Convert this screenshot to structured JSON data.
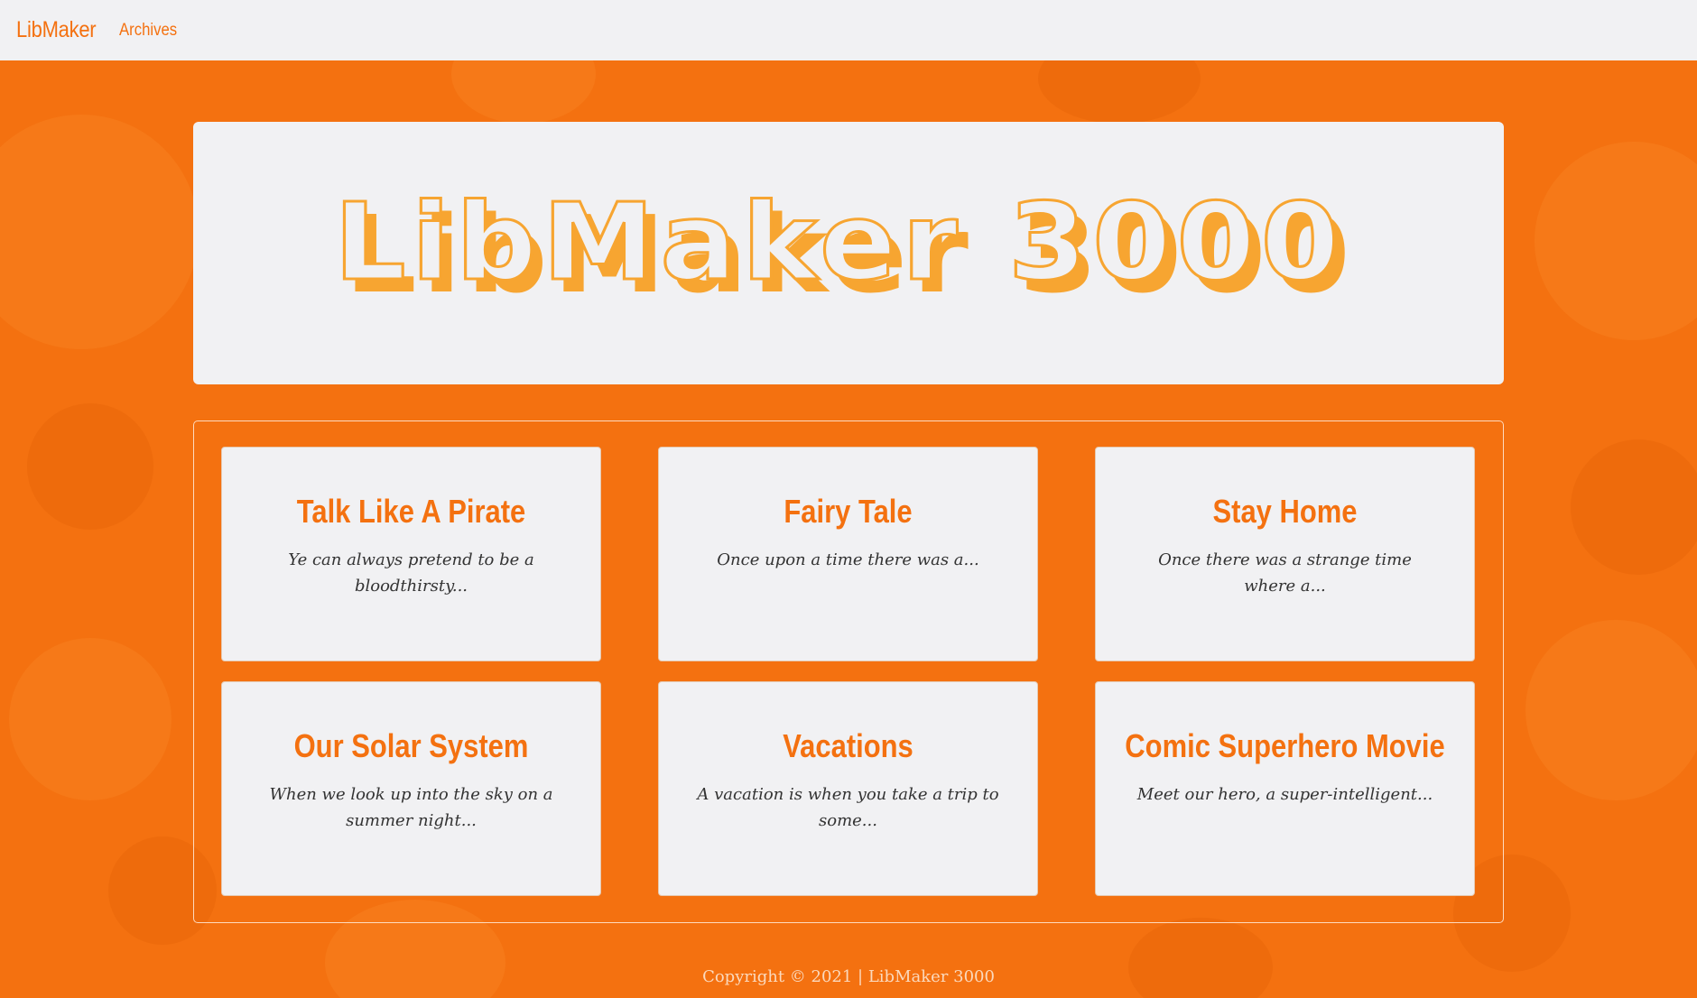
{
  "nav": {
    "brand": "LibMaker",
    "links": [
      "Archives"
    ]
  },
  "hero": {
    "logo_text": "LibMaker 3000"
  },
  "cards": [
    {
      "title": "Talk Like A Pirate",
      "description": "Ye can always pretend to be a bloodthirsty..."
    },
    {
      "title": "Fairy Tale",
      "description": "Once upon a time there was a..."
    },
    {
      "title": "Stay Home",
      "description": "Once there was a strange time where a..."
    },
    {
      "title": "Our Solar System",
      "description": "When we look up into the sky on a summer night..."
    },
    {
      "title": "Vacations",
      "description": "A vacation is when you take a trip to some..."
    },
    {
      "title": "Comic Superhero Movie",
      "description": "Meet our hero, a super-intelligent..."
    }
  ],
  "footer": {
    "text": "Copyright © 2021 | LibMaker 3000"
  },
  "colors": {
    "accent": "#f47110",
    "logo_fill": "#f7a531",
    "panel": "#f1f1f3"
  }
}
